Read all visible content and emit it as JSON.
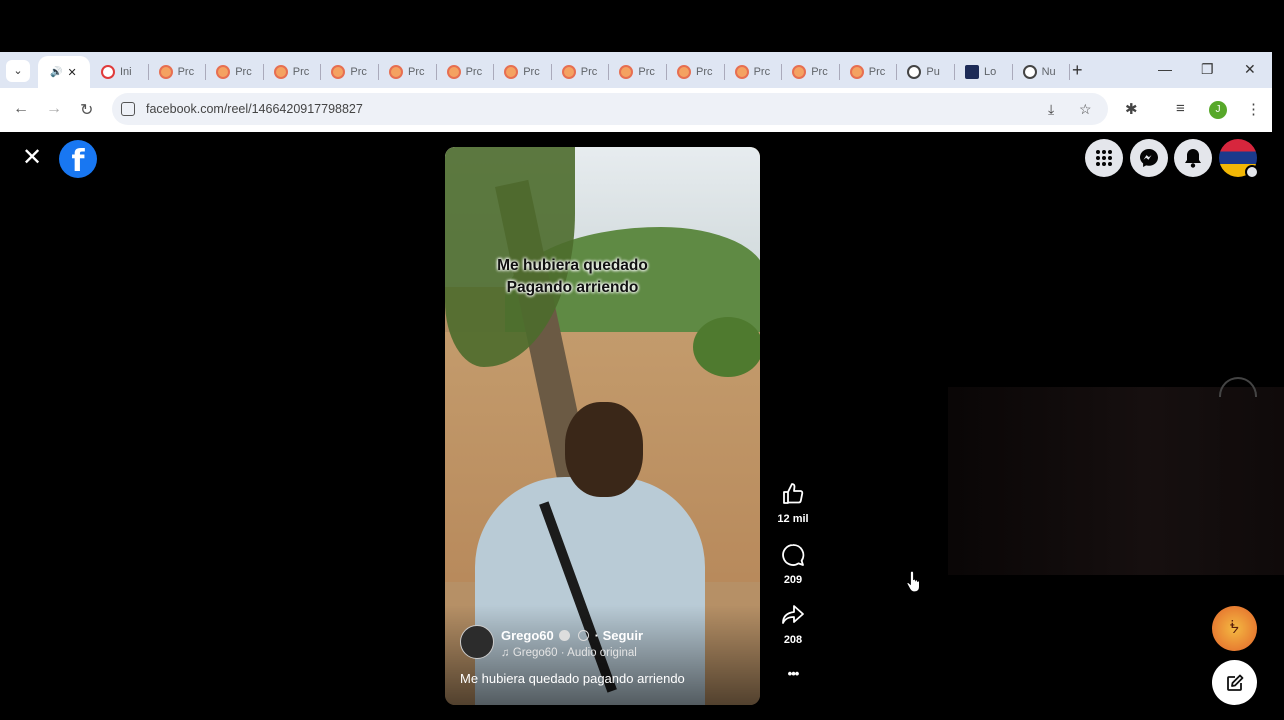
{
  "browser": {
    "tabs": [
      {
        "label": "",
        "favicon": "audio-speaker-icon",
        "active": true
      },
      {
        "label": "Ini",
        "favicon": "red-clock-icon"
      },
      {
        "label": "Prc",
        "favicon": "orange-circle-icon"
      },
      {
        "label": "Prc",
        "favicon": "orange-circle-icon"
      },
      {
        "label": "Prc",
        "favicon": "orange-circle-icon"
      },
      {
        "label": "Prc",
        "favicon": "orange-circle-icon"
      },
      {
        "label": "Prc",
        "favicon": "orange-circle-icon"
      },
      {
        "label": "Prc",
        "favicon": "orange-circle-icon"
      },
      {
        "label": "Prc",
        "favicon": "orange-circle-icon"
      },
      {
        "label": "Prc",
        "favicon": "orange-circle-icon"
      },
      {
        "label": "Prc",
        "favicon": "orange-circle-icon"
      },
      {
        "label": "Prc",
        "favicon": "orange-circle-icon"
      },
      {
        "label": "Prc",
        "favicon": "orange-circle-icon"
      },
      {
        "label": "Prc",
        "favicon": "orange-circle-icon"
      },
      {
        "label": "Prc",
        "favicon": "orange-circle-icon"
      },
      {
        "label": "Pu",
        "favicon": "openai-icon"
      },
      {
        "label": "Lo",
        "favicon": "dark-square-icon"
      },
      {
        "label": "Nu",
        "favicon": "globe-icon"
      }
    ],
    "new_tab": "+",
    "window_controls": {
      "minimize": "—",
      "restore": "❐",
      "close": "✕"
    },
    "url": "facebook.com/reel/1466420917798827",
    "profile_initial": "J"
  },
  "facebook": {
    "close": "✕",
    "logo": "f"
  },
  "reel": {
    "caption_line1": "Me hubiera quedado",
    "caption_line2": "Pagando arriendo",
    "author": "Grego60",
    "follow": "· Seguir",
    "audio": "♫ Grego60 · Audio original",
    "description": "Me hubiera quedado pagando arriendo",
    "likes": "12 mil",
    "comments": "209",
    "shares": "208",
    "more": "•••"
  },
  "colors": {
    "fb_blue": "#1877f2",
    "bg": "#000000"
  }
}
